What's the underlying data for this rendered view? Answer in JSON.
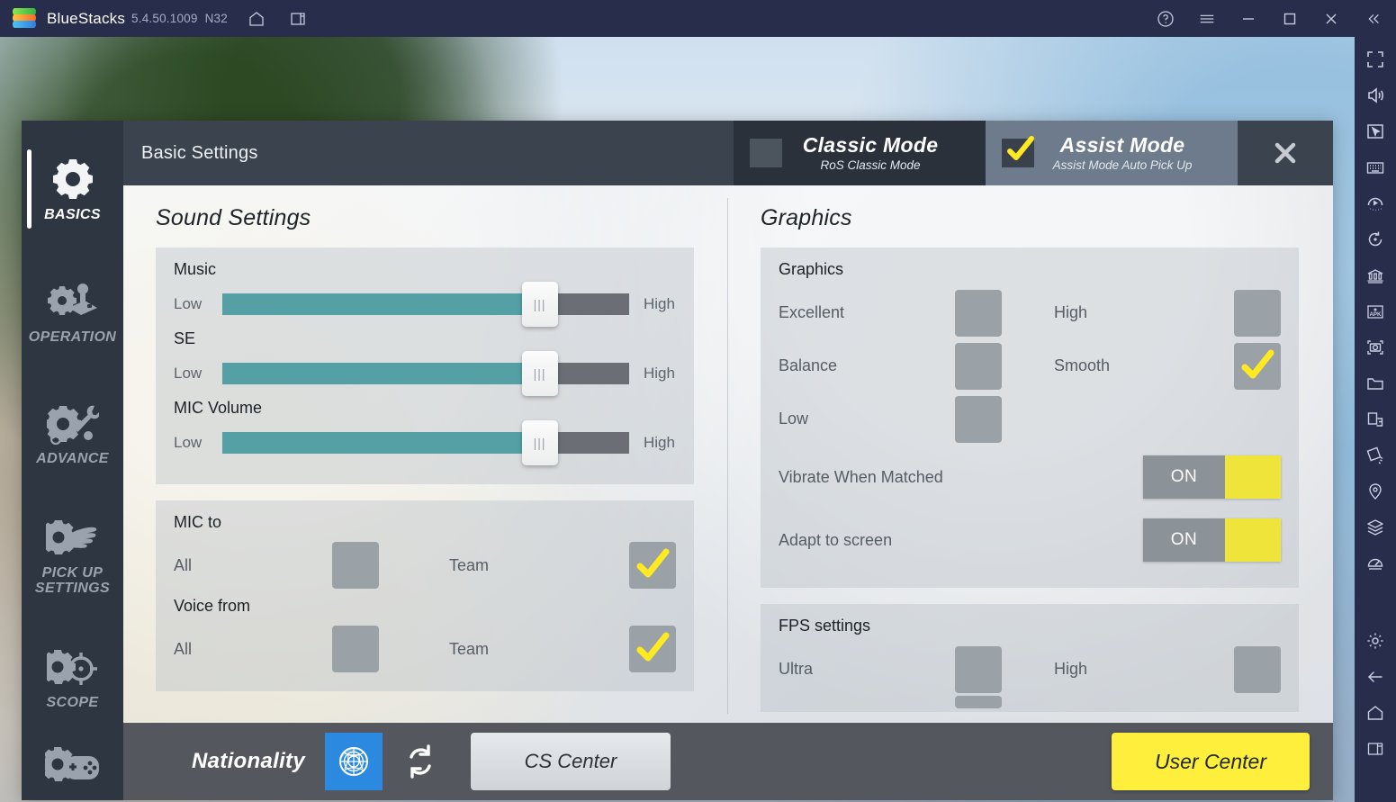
{
  "titlebar": {
    "app_name": "BlueStacks",
    "version": "5.4.50.1009",
    "build": "N32",
    "icons": [
      "home-icon",
      "multi-instance-icon"
    ],
    "right_icons": [
      "help-icon",
      "menu-icon",
      "minimize-icon",
      "maximize-icon",
      "close-icon",
      "collapse-icon"
    ]
  },
  "sidebar_tools": [
    "fullscreen-icon",
    "volume-icon",
    "cursor-icon",
    "keyboard-icon",
    "macro-record-icon",
    "rotate-icon",
    "multi-instance-manager-icon",
    "install-apk-icon",
    "screenshot-icon",
    "media-folder-icon",
    "copy-to-pc-icon",
    "shake-icon",
    "location-icon",
    "layers-icon",
    "meter-icon",
    "settings-gear-icon",
    "back-icon",
    "home-nav-icon",
    "recents-icon"
  ],
  "dialog": {
    "title": "Basic Settings",
    "close_icon": "close-icon",
    "modes": [
      {
        "name": "Classic Mode",
        "subtitle": "RoS Classic Mode",
        "checked": false
      },
      {
        "name": "Assist Mode",
        "subtitle": "Assist Mode Auto Pick Up",
        "checked": true
      }
    ]
  },
  "nav": {
    "items": [
      {
        "label": "BASICS",
        "icon": "gear-icon",
        "active": true
      },
      {
        "label": "OPERATION",
        "icon": "gear-joystick-icon",
        "active": false
      },
      {
        "label": "ADVANCE",
        "icon": "gear-wrench-icon",
        "active": false
      },
      {
        "label": "PICK UP\nSETTINGS",
        "label_line1": "PICK UP",
        "label_line2": "SETTINGS",
        "icon": "gear-hand-icon",
        "active": false
      },
      {
        "label": "SCOPE",
        "icon": "gear-scope-icon",
        "active": false
      },
      {
        "label": "",
        "icon": "gear-gamepad-icon",
        "active": false
      }
    ]
  },
  "sound": {
    "section_title": "Sound Settings",
    "sliders": [
      {
        "label": "Music",
        "low": "Low",
        "high": "High",
        "value": 78
      },
      {
        "label": "SE",
        "low": "Low",
        "high": "High",
        "value": 78
      },
      {
        "label": "MIC Volume",
        "low": "Low",
        "high": "High",
        "value": 78
      }
    ],
    "mic_to": {
      "head": "MIC to",
      "left_label": "All",
      "left_checked": false,
      "right_label": "Team",
      "right_checked": true
    },
    "voice_from": {
      "head": "Voice from",
      "left_label": "All",
      "left_checked": false,
      "right_label": "Team",
      "right_checked": true
    }
  },
  "graphics": {
    "section_title": "Graphics",
    "card_head": "Graphics",
    "quality": [
      {
        "left": "Excellent",
        "left_checked": false,
        "right": "High",
        "right_checked": false
      },
      {
        "left": "Balance",
        "left_checked": false,
        "right": "Smooth",
        "right_checked": true
      },
      {
        "left": "Low",
        "left_checked": false,
        "right": "",
        "right_checked": null
      }
    ],
    "toggles": [
      {
        "label": "Vibrate When Matched",
        "state": "ON"
      },
      {
        "label": "Adapt to screen",
        "state": "ON"
      }
    ],
    "fps": {
      "card_head": "FPS settings",
      "rows": [
        {
          "left": "Ultra",
          "left_checked": false,
          "right": "High",
          "right_checked": false
        }
      ]
    }
  },
  "footer": {
    "nationality_label": "Nationality",
    "flag_icon": "un-flag-icon",
    "refresh_icon": "refresh-icon",
    "cs_center_label": "CS Center",
    "user_center_label": "User Center"
  },
  "colors": {
    "accent_yellow": "#ffef3d",
    "check_yellow": "#ffe920",
    "slider_teal": "#54a0a5",
    "slider_track": "#6b6e74",
    "titlebar_bg": "#282d4b",
    "dialog_header": "#3b434e",
    "nav_bg": "#2e3642",
    "footer_bg": "#54585e",
    "mode_active_bg": "#6d7b8c",
    "flag_blue": "#2b8ae0"
  }
}
